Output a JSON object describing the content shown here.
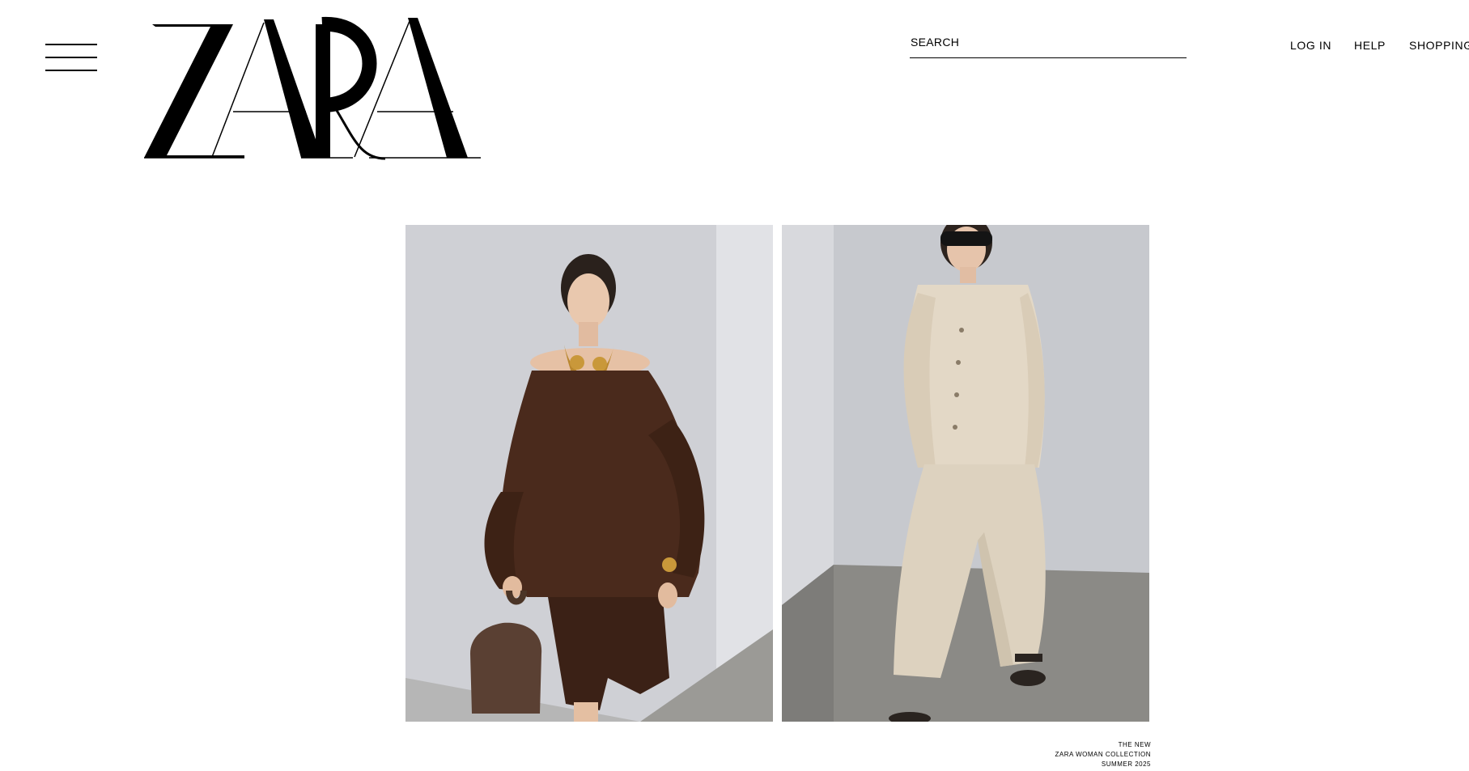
{
  "header": {
    "menu_icon": "hamburger-menu-icon",
    "logo_text": "ZARA",
    "search": {
      "label": "SEARCH"
    },
    "nav": {
      "login": "LOG IN",
      "help": "HELP",
      "shopping": "SHOPPING"
    }
  },
  "hero": {
    "images": [
      {
        "name": "model-brown-blouse-photo"
      },
      {
        "name": "model-linen-suit-photo"
      }
    ],
    "caption": {
      "line1": "THE NEW",
      "line2": "ZARA WOMAN COLLECTION",
      "line3": "SUMMER 2025"
    }
  },
  "colors": {
    "text": "#000000",
    "background": "#ffffff",
    "studio_wall": "#c9cbd0",
    "blouse_brown": "#4a2a1c",
    "linen_beige": "#ddd2bf"
  }
}
